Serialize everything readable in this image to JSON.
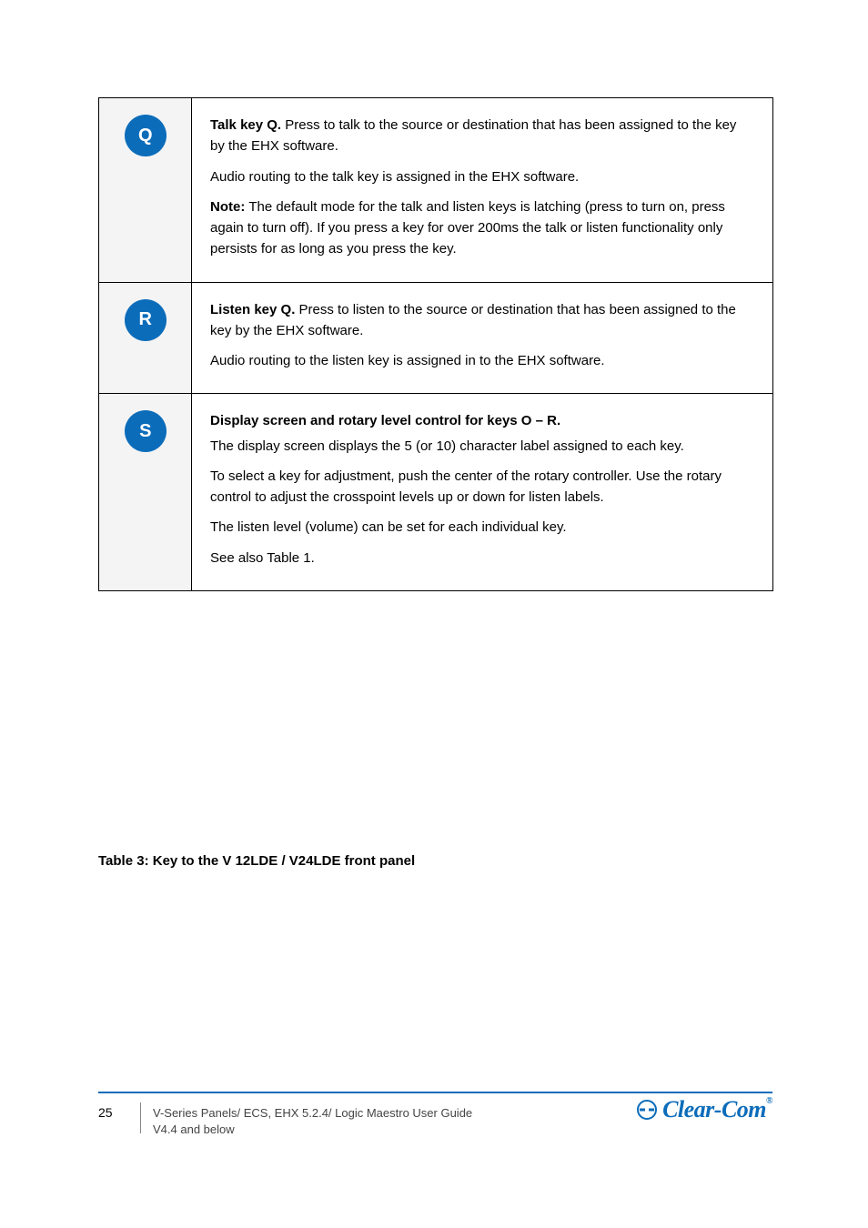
{
  "rows": [
    {
      "badge": "Q",
      "lead": "Talk key Q.",
      "paras": [
        {
          "text": "Press to talk to the source or destination that has been assigned to the key by the EHX software."
        },
        {
          "text": "Audio routing to the talk key is assigned in the EHX software."
        },
        {
          "note": true,
          "text": "The default mode for the talk and listen keys is latching (press to turn on, press again to turn off). If you press a key for over 200ms the talk or listen functionality only persists for as long as you press the key."
        }
      ]
    },
    {
      "badge": "R",
      "lead": "Listen key Q.",
      "paras": [
        {
          "text": "Press to listen to the source or destination that has been assigned to the key by the EHX software."
        },
        {
          "text": "Audio routing to the listen key is assigned in to the EHX software."
        }
      ]
    },
    {
      "badge": "S",
      "lead": "Display screen and rotary level control for keys O – R.",
      "paras": [
        {
          "text": "The display screen displays the 5 (or 10) character label assigned to each key."
        },
        {
          "text": "To select a key for adjustment, push the center of the rotary controller. Use the rotary control to adjust the crosspoint levels up or down for listen labels."
        },
        {
          "text": "The listen level (volume) can be set for each individual key."
        },
        {
          "text": "See also Table 1."
        }
      ]
    }
  ],
  "caption": "Table 3: Key to the V 12LDE / V24LDE front panel",
  "footer": {
    "page": "25",
    "title_line1": "V-Series Panels/ ECS, EHX 5.2.4/ Logic Maestro User Guide",
    "title_line2": "V4.4 and below",
    "brand": "Clear-Com",
    "reg": "®"
  }
}
